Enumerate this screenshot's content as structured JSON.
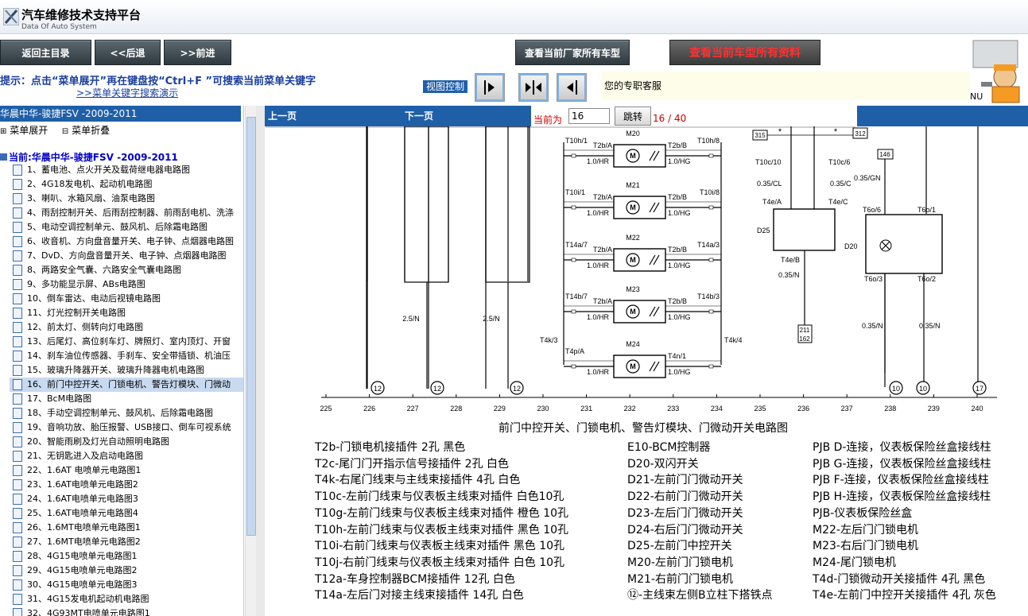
{
  "app": {
    "title": "汽车维修技术支持平台",
    "subtitle": "Data Of Auto System"
  },
  "toolbar": {
    "home": "返回主目录",
    "back": "<<后退",
    "forward": ">>前进",
    "all_models": "查看当前厂家所有车型",
    "all_data": "查看当前车型所有资料"
  },
  "hint": {
    "text": "提示：点击“菜单展开”再在键盘按“Ctrl+F ”可搜索当前菜单关键字",
    "link": ">>菜单关键字搜索演示",
    "view_control": "视图控制",
    "service": "您的专职客服",
    "nu": "NU"
  },
  "sidebar": {
    "header": "华晨中华-骏捷FSV -2009-2011",
    "expand": "菜单展开",
    "collapse": "菜单折叠",
    "current": "当前:华晨中华-骏捷FSV -2009-2011",
    "items": [
      "1、蓄电池、点火开关及载荷继电器电路图",
      "2、4G18发电机、起动机电路图",
      "3、喇叭、水箱风扇、油泵电路图",
      "4、雨刮控制开关、后雨刮控制器、前雨刮电机、洗涤",
      "5、电动空调控制单元、鼓风机、后除霜电路图",
      "6、收音机、方向盘音量开关、电子钟、点烟器电路图",
      "7、DvD、方向盘音量开关、电子钟、点烟器电路图",
      "8、两路安全气囊、六路安全气囊电路图",
      "9、多功能显示屏、ABs电路图",
      "10、倒车雷达、电动后视镜电路图",
      "11、灯光控制开关电路图",
      "12、前太灯、侧转向灯电路图",
      "13、后尾灯、高位刹车灯、牌照灯、室内顶灯、开窗",
      "14、刹车油位传感器、手刹车、安全带插锁、机油压",
      "15、玻璃升降器开关、玻璃升降器电机电路图",
      "16、前门中控开关、门锁电机、警告灯模块、门微动",
      "17、BcM电路图",
      "18、手动空调控制单元、鼓风机、后除霜电路图",
      "19、音响功放、胎压报警、USB接口、倒车可视系统",
      "20、智能雨刷及灯光自动照明电路图",
      "21、无钥匙进入及启动电路图",
      "22、1.6AT 电喷单元电路图1",
      "23、1.6AT电喷单元电路图2",
      "24、1.6AT电喷单元电路图3",
      "25、1.6AT电喷单元电路图4",
      "26、1.6MT电喷单元电路图1",
      "27、1.6MT电喷单元电路图2",
      "28、4G15电喷单元电路图1",
      "29、4G15电喷单元电路图2",
      "30、4G15电喷单元电路图3",
      "31、4G15发电机起动机电路图",
      "32、4G93MT电喷单元电路图1"
    ],
    "selected_index": 15
  },
  "nav": {
    "prev": "上一页",
    "next": "下一页",
    "current_label": "当前为",
    "page_value": "16",
    "jump": "跳转",
    "page_count": "16 / 40"
  },
  "diagram": {
    "title": "前门中控开关、门锁电机、警告灯模块、门微动开关电路图",
    "columns": [
      "225",
      "226",
      "227",
      "228",
      "229",
      "230",
      "231",
      "232",
      "233",
      "234",
      "235",
      "236",
      "237",
      "238",
      "239",
      "240"
    ],
    "motors": [
      {
        "name": "M20",
        "l_conn": "T10h/1",
        "l_pin": "T2b/A",
        "l_wire": "1.0/HR",
        "r_pin": "T2b/B",
        "r_conn": "T10h/8",
        "r_wire": "1.0/HG"
      },
      {
        "name": "M21",
        "l_conn": "T10i/1",
        "l_pin": "T2b/A",
        "l_wire": "1.0/HR",
        "r_pin": "T2b/B",
        "r_conn": "T10i/8",
        "r_wire": "1.0/HG"
      },
      {
        "name": "M22",
        "l_conn": "T14a/7",
        "l_pin": "T2b/A",
        "l_wire": "1.0/HR",
        "r_pin": "T2b/B",
        "r_conn": "T14a/3",
        "r_wire": "1.0/HG"
      },
      {
        "name": "M23",
        "l_conn": "T14b/7",
        "l_pin": "T2b/A",
        "l_wire": "1.0/HR",
        "r_pin": "T2b/B",
        "r_conn": "T14b/3",
        "r_wire": "1.0/HG"
      },
      {
        "name": "M24",
        "l_conn": "T4p/A",
        "l_pin": "",
        "l_wire": "1.0/HR",
        "r_pin": "T4n/1",
        "r_conn": "",
        "r_wire": "1.0/HG"
      }
    ],
    "labels": {
      "wire_25n": "2.5/N",
      "t4k3": "T4k/3",
      "t4k4": "T4k/4",
      "c315": "315",
      "c312": "312",
      "c146": "146",
      "c211": "211",
      "c162": "162",
      "t10c10": "T10c/10",
      "t10c6": "T10c/6",
      "w035cl": "0.35/CL",
      "w035c": "0.35/C",
      "w035gn": "0.35/GN",
      "t4ea": "T4e/A",
      "t4ec": "T4e/C",
      "t4eb": "T4e/B",
      "d25": "D25",
      "d20": "D20",
      "t6o6": "T6o/6",
      "t6o1": "T6o/1",
      "t6o3": "T6o/3",
      "t6o2": "T6o/2",
      "w035n": "0.35/N",
      "star": "*",
      "g12": "12",
      "g10": "10",
      "g17": "17"
    }
  },
  "legend": {
    "col1": [
      "T2b-门锁电机接插件 2孔 黑色",
      "T2c-尾门门开指示信号接插件 2孔 白色",
      "T4k-右尾门线束与主线束接插件 4孔 白色",
      "T10c-左前门线束与仪表板主线束对插件 白色10孔",
      "T10g-左前门线束与仪表板主线束对插件 橙色 10孔",
      "T10h-左前门线束与仪表板主线束对插件 黑色 10孔",
      "T10i-右前门线束与仪表板主线束对插件 黑色 10孔",
      "T10j-右前门线束与仪表板主线束对插件 白色 10孔",
      "T12a-车身控制器BCM接插件 12孔 白色",
      "T14a-左后门对接主线束接插件 14孔 白色"
    ],
    "col2": [
      "E10-BCM控制器",
      "D20-双闪开关",
      "D21-左前门门微动开关",
      "D22-右前门门微动开关",
      "D23-左后门门微动开关",
      "D24-右后门门微动开关",
      "D25-左前门中控开关",
      "M20-左前门门锁电机",
      "M21-右前门门锁电机",
      "⑫-主线束左侧B立柱下搭铁点"
    ],
    "col3": [
      "PJB D-连接，仪表板保险丝盒接线柱",
      "PJB G-连接，仪表板保险丝盒接线柱",
      "PJB F-连接，仪表板保险丝盒接线柱",
      "PJB H-连接，仪表板保险丝盒接线柱",
      "PJB-仪表板保险丝盒",
      "M22-左后门门锁电机",
      "M23-右后门门锁电机",
      "M24-尾门锁电机",
      "T4d-门锁微动开关接插件 4孔 黑色",
      "T4e-左前门中控开关接插件 4孔 灰色"
    ]
  }
}
